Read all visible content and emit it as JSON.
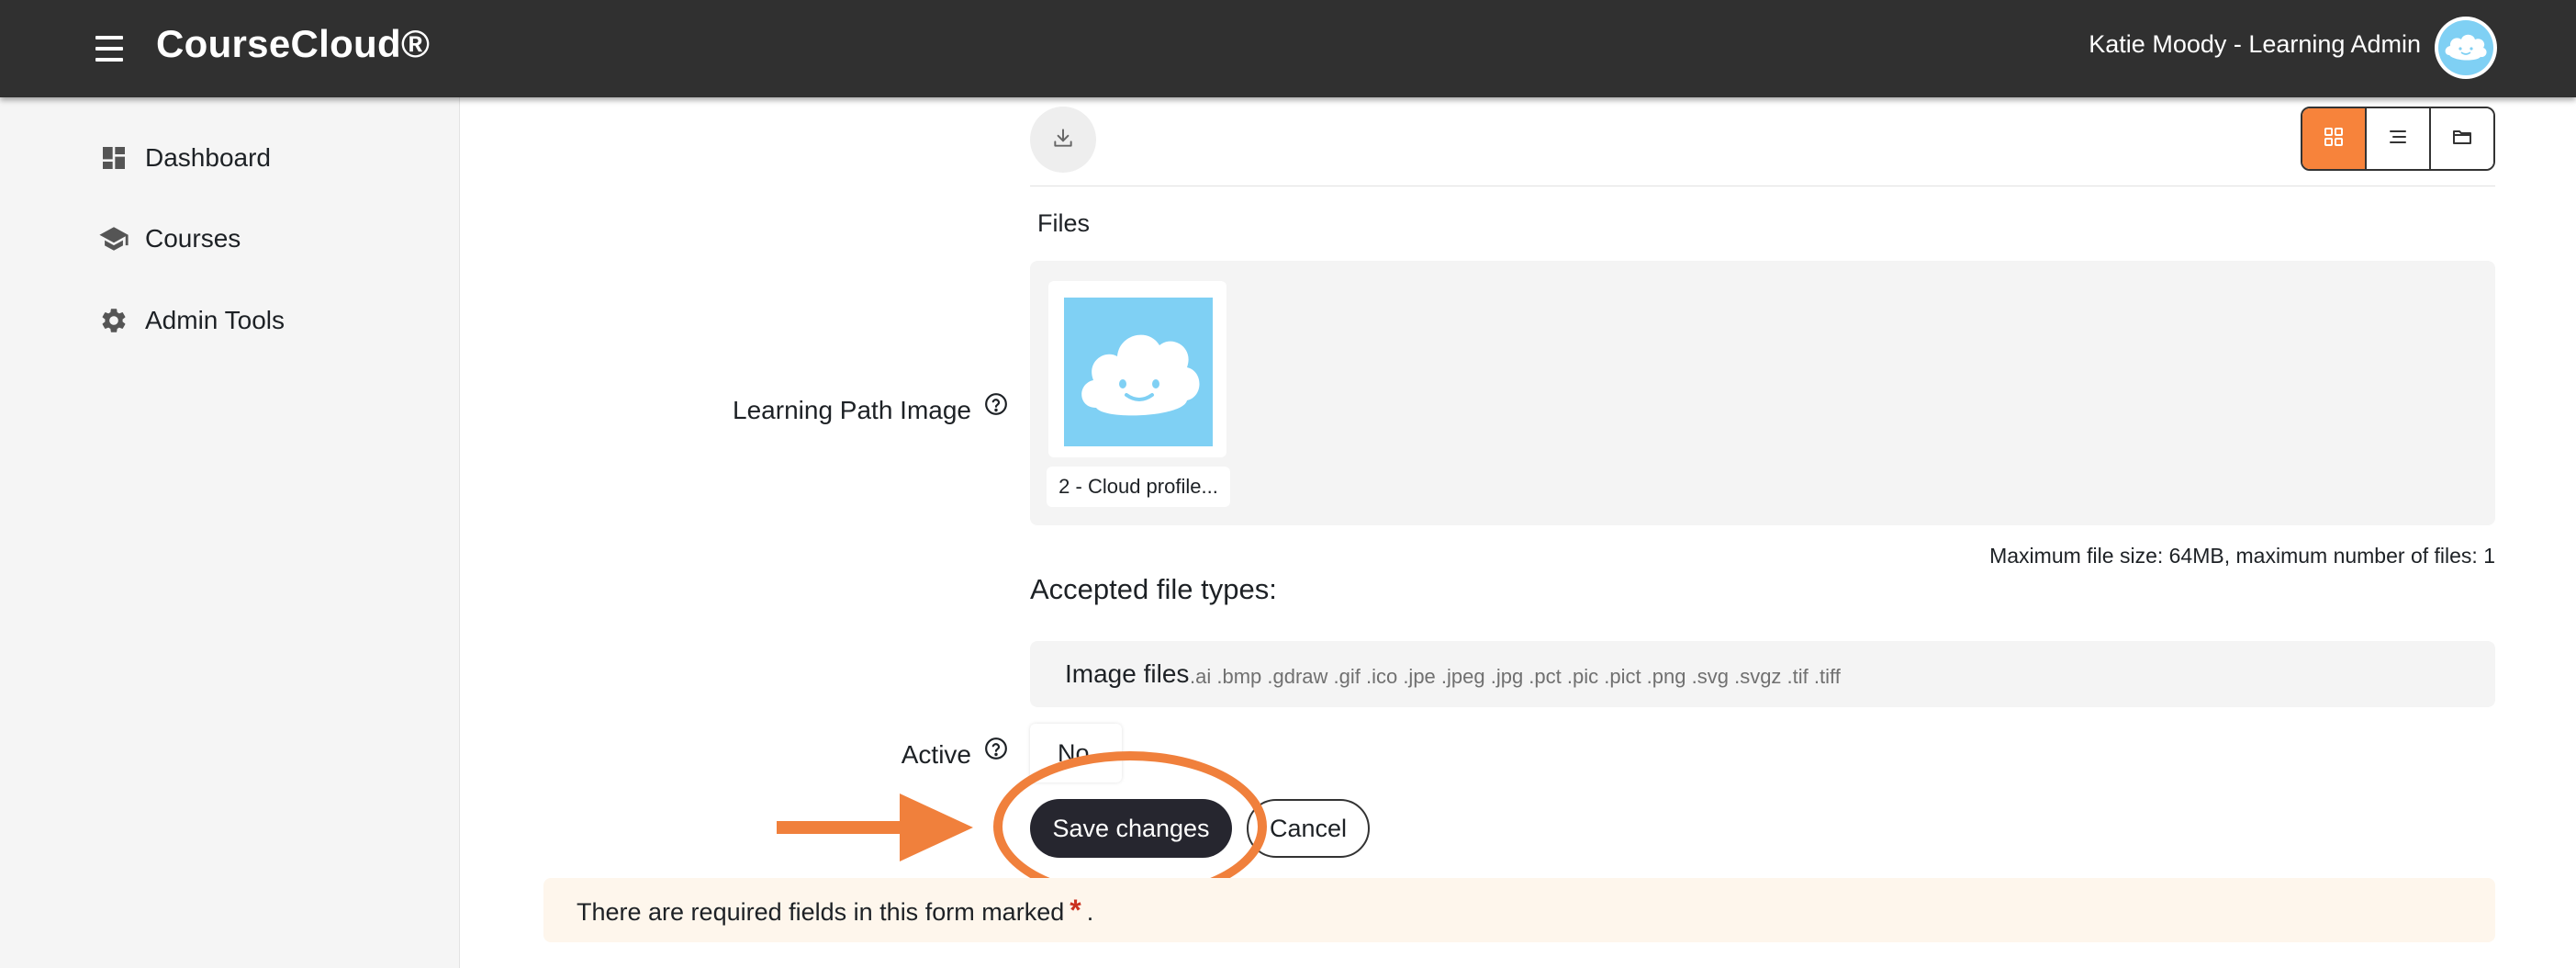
{
  "header": {
    "brand": "CourseCloud®",
    "user": "Katie Moody - Learning Admin",
    "menu_icon": "hamburger-menu-icon",
    "avatar_icon": "cloud-avatar-icon"
  },
  "sidebar": {
    "items": [
      {
        "label": "Dashboard",
        "icon": "dashboard-icon"
      },
      {
        "label": "Courses",
        "icon": "graduation-cap-icon"
      },
      {
        "label": "Admin Tools",
        "icon": "gear-icon"
      }
    ]
  },
  "filepicker": {
    "download_icon": "download-icon",
    "view_modes": [
      "grid-view-icon",
      "list-view-icon",
      "folder-view-icon"
    ],
    "active_view": "grid-view-icon",
    "files_label": "Files",
    "file_name": "2 - Cloud profile...",
    "max_size_text": "Maximum file size: 64MB, maximum number of files: 1",
    "accepted_title": "Accepted file types:",
    "types_name": "Image files",
    "types_list": ".ai .bmp .gdraw .gif .ico .jpe .jpeg .jpg .pct .pic .pict .png .svg .svgz .tif .tiff"
  },
  "form": {
    "image_label": "Learning Path Image",
    "active_label": "Active",
    "active_value": "No",
    "save_label": "Save changes",
    "cancel_label": "Cancel",
    "required_text": "There are required fields in this form marked",
    "required_marker": "*",
    "required_tail": "."
  },
  "colors": {
    "topbar": "#303030",
    "accent": "#f7833b",
    "annotation": "#f0803c",
    "primary_button": "#26262f",
    "required_bg": "#fef6ec",
    "required_star": "#ca3120"
  }
}
